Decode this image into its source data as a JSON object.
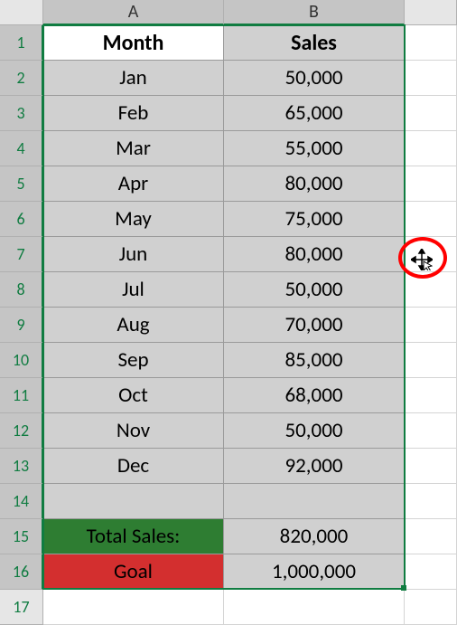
{
  "columns": {
    "a": "A",
    "b": "B"
  },
  "rowNumbers": [
    "1",
    "2",
    "3",
    "4",
    "5",
    "6",
    "7",
    "8",
    "9",
    "10",
    "11",
    "12",
    "13",
    "14",
    "15",
    "16",
    "17"
  ],
  "headers": {
    "month": "Month",
    "sales": "Sales"
  },
  "months": {
    "jan": "Jan",
    "feb": "Feb",
    "mar": "Mar",
    "apr": "Apr",
    "may": "May",
    "jun": "Jun",
    "jul": "Jul",
    "aug": "Aug",
    "sep": "Sep",
    "oct": "Oct",
    "nov": "Nov",
    "dec": "Dec"
  },
  "sales": {
    "jan": "50,000",
    "feb": "65,000",
    "mar": "55,000",
    "apr": "80,000",
    "may": "75,000",
    "jun": "80,000",
    "jul": "50,000",
    "aug": "70,000",
    "sep": "85,000",
    "oct": "68,000",
    "nov": "50,000",
    "dec": "92,000"
  },
  "summary": {
    "totalLabel": "Total Sales:",
    "totalValue": "820,000",
    "goalLabel": "Goal",
    "goalValue": "1,000,000"
  }
}
